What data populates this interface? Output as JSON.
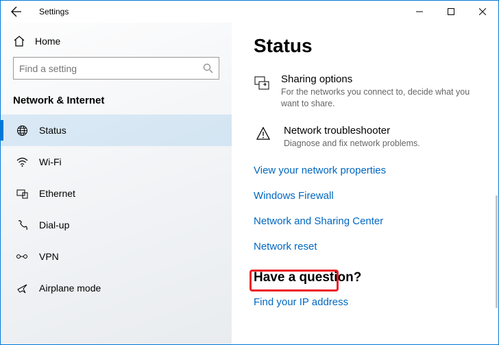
{
  "titlebar": {
    "title": "Settings"
  },
  "sidebar": {
    "home": "Home",
    "search_placeholder": "Find a setting",
    "section": "Network & Internet",
    "items": [
      {
        "label": "Status",
        "icon": "globe-icon",
        "selected": true
      },
      {
        "label": "Wi-Fi",
        "icon": "wifi-icon",
        "selected": false
      },
      {
        "label": "Ethernet",
        "icon": "ethernet-icon",
        "selected": false
      },
      {
        "label": "Dial-up",
        "icon": "dialup-icon",
        "selected": false
      },
      {
        "label": "VPN",
        "icon": "vpn-icon",
        "selected": false
      },
      {
        "label": "Airplane mode",
        "icon": "airplane-icon",
        "selected": false
      }
    ]
  },
  "main": {
    "heading": "Status",
    "blocks": [
      {
        "title": "Sharing options",
        "subtitle": "For the networks you connect to, decide what you want to share.",
        "icon": "share-icon"
      },
      {
        "title": "Network troubleshooter",
        "subtitle": "Diagnose and fix network problems.",
        "icon": "warning-icon"
      }
    ],
    "links": [
      "View your network properties",
      "Windows Firewall",
      "Network and Sharing Center",
      "Network reset"
    ],
    "question_heading": "Have a question?",
    "question_link": "Find your IP address"
  },
  "highlight": {
    "target_link_index": 3
  }
}
